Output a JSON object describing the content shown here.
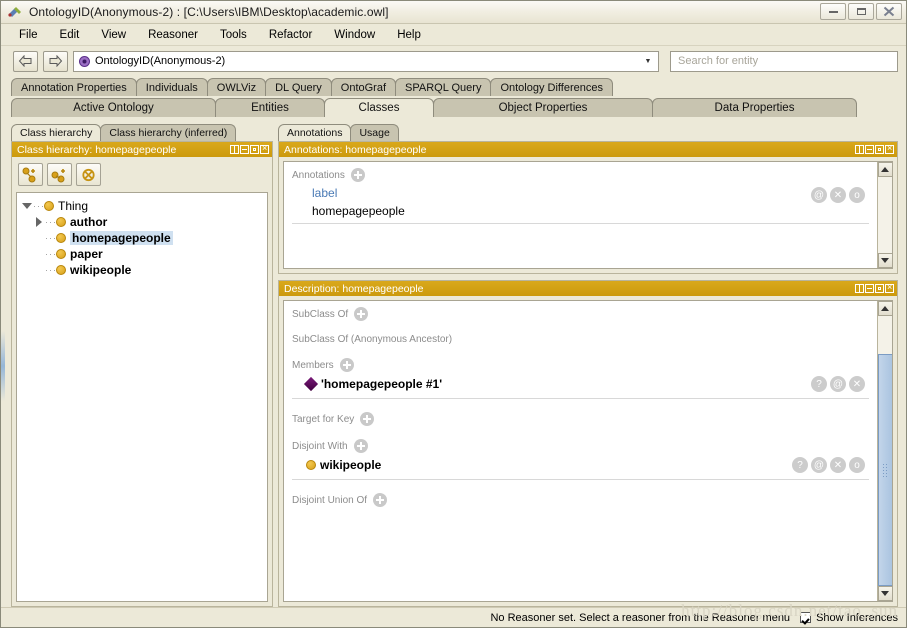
{
  "window": {
    "title": "OntologyID(Anonymous-2) : [C:\\Users\\IBM\\Desktop\\academic.owl]",
    "minimize": "−",
    "maximize": "▣",
    "close": "✕"
  },
  "menu": {
    "items": [
      "File",
      "Edit",
      "View",
      "Reasoner",
      "Tools",
      "Refactor",
      "Window",
      "Help"
    ]
  },
  "toolbar": {
    "back": "◁",
    "forward": "▷",
    "ontology_combo_value": "OntologyID(Anonymous-2)",
    "combo_arrow": "▼",
    "search_placeholder": "Search for entity",
    "search_value": ""
  },
  "tabs_top": [
    "Annotation Properties",
    "Individuals",
    "OWLViz",
    "DL Query",
    "OntoGraf",
    "SPARQL Query",
    "Ontology Differences"
  ],
  "tabs_main": [
    {
      "label": "Active Ontology",
      "active": false
    },
    {
      "label": "Entities",
      "active": false
    },
    {
      "label": "Classes",
      "active": true
    },
    {
      "label": "Object Properties",
      "active": false
    },
    {
      "label": "Data Properties",
      "active": false
    }
  ],
  "class_hierarchy": {
    "tabs": [
      {
        "label": "Class hierarchy",
        "active": true
      },
      {
        "label": "Class hierarchy (inferred)",
        "active": false
      }
    ],
    "panel_title": "Class hierarchy: homepagepeople",
    "buttons": [
      {
        "name": "add-subclass",
        "tip": "Add subclass"
      },
      {
        "name": "add-sibling-class",
        "tip": "Add sibling class"
      },
      {
        "name": "delete-class",
        "tip": "Delete class"
      }
    ],
    "tree": [
      {
        "label": "Thing",
        "level": 0,
        "expander": "down",
        "selected": false,
        "bold": false
      },
      {
        "label": "author",
        "level": 1,
        "expander": "right",
        "selected": false,
        "bold": true
      },
      {
        "label": "homepagepeople",
        "level": 1,
        "expander": "none",
        "selected": true,
        "bold": true
      },
      {
        "label": "paper",
        "level": 1,
        "expander": "none",
        "selected": false,
        "bold": true
      },
      {
        "label": "wikipeople",
        "level": 1,
        "expander": "none",
        "selected": false,
        "bold": true
      }
    ]
  },
  "annotations_panel": {
    "tabs": [
      {
        "label": "Annotations",
        "active": true
      },
      {
        "label": "Usage",
        "active": false
      }
    ],
    "panel_title": "Annotations: homepagepeople",
    "section_label": "Annotations",
    "rows": [
      {
        "property": "label",
        "value": "homepagepeople",
        "icons": [
          "@",
          "✕",
          "o"
        ]
      }
    ]
  },
  "description_panel": {
    "panel_title": "Description: homepagepeople",
    "sections": [
      {
        "label": "SubClass Of",
        "has_add": true,
        "items": []
      },
      {
        "label": "SubClass Of (Anonymous Ancestor)",
        "has_add": false,
        "items": []
      },
      {
        "label": "Members",
        "has_add": true,
        "items": [
          {
            "text": "'homepagepeople #1'",
            "icon": "individual-diamond",
            "actions": [
              "?",
              "@",
              "✕"
            ]
          }
        ]
      },
      {
        "label": "Target for Key",
        "has_add": true,
        "items": []
      },
      {
        "label": "Disjoint With",
        "has_add": true,
        "items": [
          {
            "text": "wikipeople",
            "icon": "class-dot",
            "actions": [
              "?",
              "@",
              "✕",
              "o"
            ]
          }
        ]
      },
      {
        "label": "Disjoint Union Of",
        "has_add": true,
        "items": []
      }
    ]
  },
  "statusbar": {
    "message": "No Reasoner set. Select a reasoner from the Reasoner menu",
    "show_inferences_label": "Show Inferences",
    "show_inferences_checked": true
  },
  "watermark": "http://blog.csdn.net/tao_sun",
  "colors": {
    "panel_header": "#d4a017",
    "selection": "#cfe0f0",
    "class_icon": "#d8a01a",
    "individual_icon": "#5a0d5a",
    "link": "#4a7ab5",
    "chrome": "#ece9d8"
  }
}
